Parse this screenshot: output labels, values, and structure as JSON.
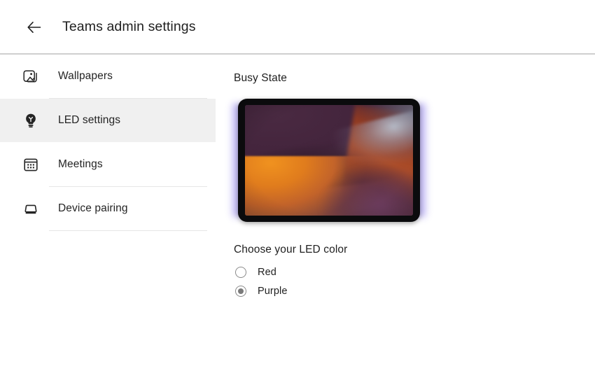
{
  "header": {
    "back_icon": "arrow-left-icon",
    "title": "Teams admin settings"
  },
  "sidebar": {
    "items": [
      {
        "label": "Wallpapers",
        "icon": "image-icon",
        "selected": false
      },
      {
        "label": "LED settings",
        "icon": "lightbulb-icon",
        "selected": true
      },
      {
        "label": "Meetings",
        "icon": "calendar-icon",
        "selected": false
      },
      {
        "label": "Device pairing",
        "icon": "device-icon",
        "selected": false
      }
    ]
  },
  "main": {
    "section_title": "Busy State",
    "preview": {
      "device_type": "tablet",
      "led_glow_color": "#a89cf0",
      "bezel_color": "#0b0b0d"
    },
    "color_group": {
      "heading": "Choose your LED color",
      "selected": "Purple",
      "options": [
        {
          "label": "Red",
          "checked": false
        },
        {
          "label": "Purple",
          "checked": true
        }
      ]
    }
  },
  "colors": {
    "page_background": "#ffffff",
    "divider": "#cfcfcf",
    "selected_row_background": "#f0f0f0",
    "text_primary": "#1f1f1f",
    "radio_border": "#8a8a8a",
    "radio_dot": "#7a7a7a"
  }
}
